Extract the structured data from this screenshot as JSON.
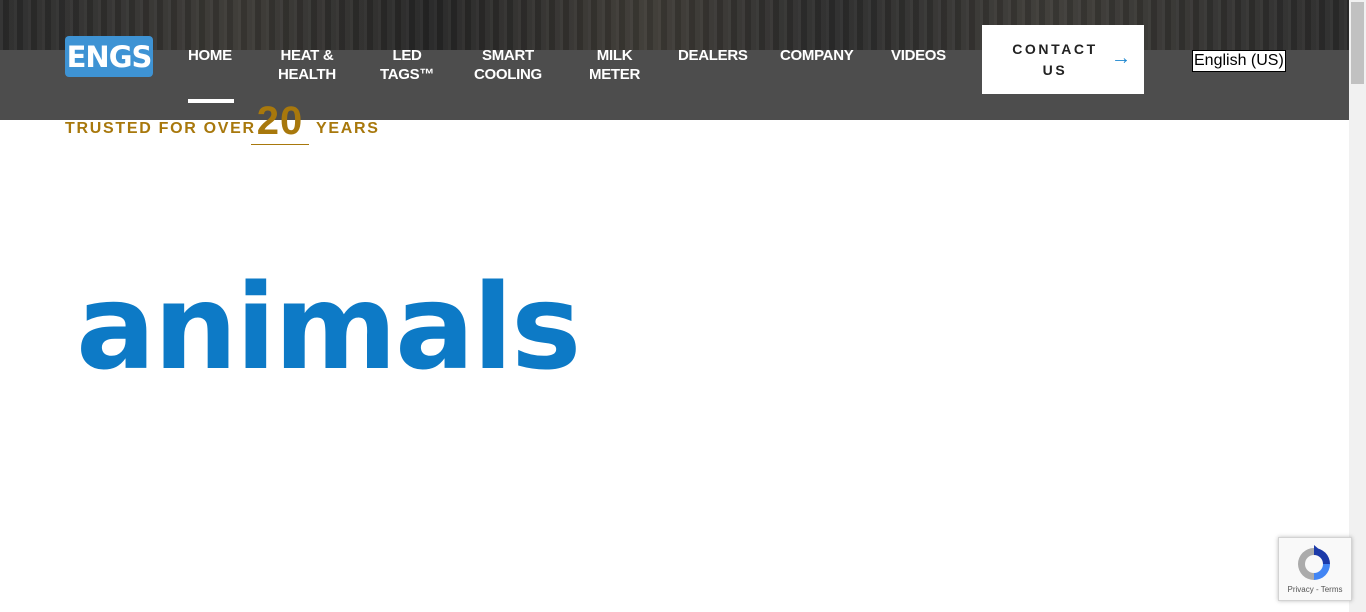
{
  "header": {
    "logo_text": "ENGS",
    "nav": [
      {
        "line1": "HOME",
        "line2": ""
      },
      {
        "line1": "HEAT &",
        "line2": "HEALTH"
      },
      {
        "line1": "LED",
        "line2": "TAGS™"
      },
      {
        "line1": "SMART",
        "line2": "COOLING"
      },
      {
        "line1": "MILK",
        "line2": "METER"
      },
      {
        "line1": "DEALERS",
        "line2": ""
      },
      {
        "line1": "COMPANY",
        "line2": ""
      },
      {
        "line1": "VIDEOS",
        "line2": ""
      }
    ],
    "active_nav": "HOME",
    "contact": {
      "line1": "CONTACT",
      "line2": "US",
      "arrow": "→"
    },
    "language": "English (US)"
  },
  "hero": {
    "trusted_prefix": "TRUSTED FOR OVER",
    "trusted_number": "20",
    "trusted_suffix": "YEARS",
    "headline_word": "animals"
  },
  "recaptcha": {
    "links": "Privacy - Terms"
  },
  "colors": {
    "header_bg": "#4d4d4d",
    "logo_bg": "#3e93d4",
    "gold": "#a8780c",
    "headline_blue": "#0d7ac6",
    "arrow_blue": "#1c86cf"
  },
  "icons": [
    "recaptcha-icon",
    "arrow-right-icon"
  ]
}
